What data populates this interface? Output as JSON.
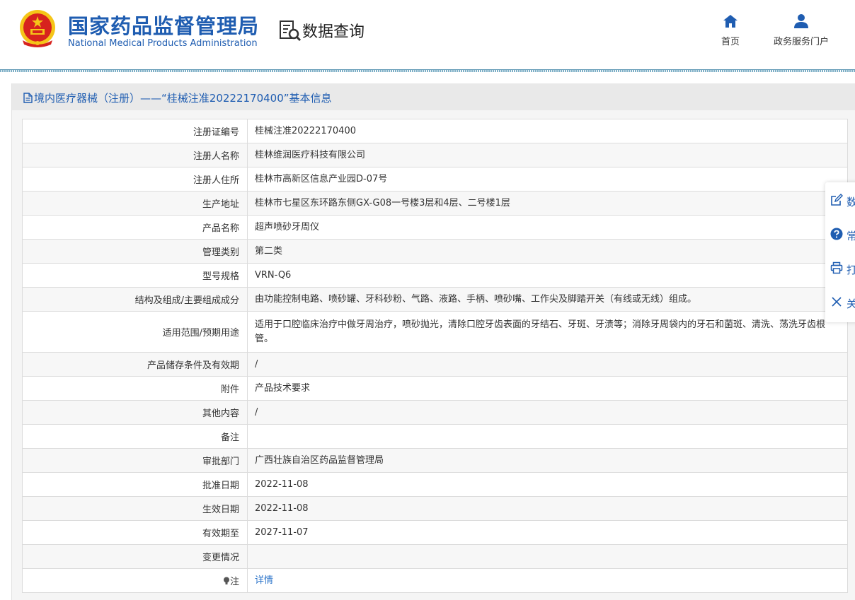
{
  "header": {
    "org_name_cn": "国家药品监督管理局",
    "org_name_en": "National Medical Products Administration",
    "section_title": "数据查询",
    "nav": [
      {
        "label": "首页",
        "icon": "home-icon"
      },
      {
        "label": "政务服务门户",
        "icon": "user-icon"
      }
    ]
  },
  "panel": {
    "title": "境内医疗器械（注册）——“桂械注准20222170400”基本信息"
  },
  "rows": [
    {
      "key": "注册证编号",
      "value": "桂械注准20222170400"
    },
    {
      "key": "注册人名称",
      "value": "桂林维润医疗科技有限公司"
    },
    {
      "key": "注册人住所",
      "value": "桂林市高新区信息产业园D-07号"
    },
    {
      "key": "生产地址",
      "value": "桂林市七星区东环路东侧GX-G08一号楼3层和4层、二号楼1层"
    },
    {
      "key": "产品名称",
      "value": "超声喷砂牙周仪"
    },
    {
      "key": "管理类别",
      "value": "第二类"
    },
    {
      "key": "型号规格",
      "value": "VRN-Q6"
    },
    {
      "key": "结构及组成/主要组成成分",
      "value": "由功能控制电路、喷砂罐、牙科砂粉、气路、液路、手柄、喷砂嘴、工作尖及脚踏开关（有线或无线）组成。"
    },
    {
      "key": "适用范围/预期用途",
      "value": "适用于口腔临床治疗中做牙周治疗，喷砂抛光，清除口腔牙齿表面的牙结石、牙斑、牙渍等；消除牙周袋内的牙石和菌斑、清洗、荡洗牙齿根管。"
    },
    {
      "key": "产品储存条件及有效期",
      "value": "/"
    },
    {
      "key": "附件",
      "value": "产品技术要求"
    },
    {
      "key": "其他内容",
      "value": "/"
    },
    {
      "key": "备注",
      "value": ""
    },
    {
      "key": "审批部门",
      "value": "广西壮族自治区药品监督管理局"
    },
    {
      "key": "批准日期",
      "value": "2022-11-08"
    },
    {
      "key": "生效日期",
      "value": "2022-11-08"
    },
    {
      "key": "有效期至",
      "value": "2027-11-07"
    },
    {
      "key": "变更情况",
      "value": ""
    },
    {
      "key": "注",
      "value": "详情"
    }
  ],
  "float_bar": [
    {
      "label": "数",
      "icon": "edit-icon"
    },
    {
      "label": "常",
      "icon": "help-icon"
    },
    {
      "label": "打",
      "icon": "print-icon"
    },
    {
      "label": "关",
      "icon": "close-icon"
    }
  ],
  "colors": {
    "brand_blue": "#1f5db1",
    "link_blue": "#2a73c9",
    "emblem_red": "#d7231e",
    "emblem_gold": "#f5c518"
  }
}
